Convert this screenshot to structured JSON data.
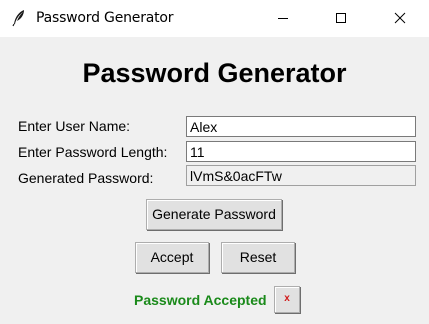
{
  "window": {
    "title": "Password Generator",
    "icon": "feather-icon",
    "controls": [
      "minimize-icon",
      "maximize-icon",
      "close-icon"
    ]
  },
  "main": {
    "heading": "Password Generator",
    "fields": {
      "user_label": "Enter User Name:",
      "user_value": "Alex",
      "length_label": "Enter Password Length:",
      "length_value": "11",
      "generated_label": "Generated Password:",
      "generated_value": "lVmS&0acFTw"
    },
    "buttons": {
      "generate": "Generate Password",
      "accept": "Accept",
      "reset": "Reset",
      "dismiss": "x"
    },
    "status": {
      "text": "Password Accepted",
      "color": "#1a8a1a"
    }
  },
  "colors": {
    "background": "#f0f0f0",
    "button_face": "#e1e1e1",
    "dismiss_x": "#d11a1a"
  }
}
